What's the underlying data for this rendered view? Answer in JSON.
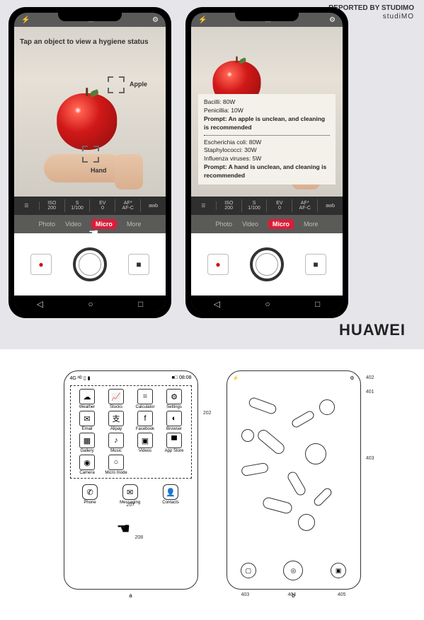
{
  "credit": {
    "line1": "REPORTED BY STUDIMO",
    "line2": "studiMO"
  },
  "phone": {
    "instruction": "Tap an object to view a hygiene status",
    "label_apple": "Apple",
    "label_hand": "Hand",
    "settings": [
      "",
      "ISO\n200",
      "S\n1/100",
      "EV\n0",
      "AF*\nAF-C",
      "awb"
    ],
    "modes": {
      "photo": "Photo",
      "video": "Video",
      "micro": "Micro",
      "more": "More"
    },
    "overlay": {
      "apple": {
        "bacilli": "Bacilli: 80W",
        "penicillia": "Penicillia: 10W",
        "prompt": "Prompt: An apple is unclean, and cleaning is recommended"
      },
      "hand": {
        "ecoli": "Escherichia coli: 80W",
        "staph": "Staphylococci: 30W",
        "flu": "Influenza viruses: 5W",
        "prompt": "Prompt: A hand is unclean, and cleaning is recommended"
      }
    }
  },
  "brand": "HUAWEI",
  "patent": {
    "time": "08:08",
    "apps": [
      {
        "label": "Weather",
        "g": "☁"
      },
      {
        "label": "Stocks",
        "g": "📈"
      },
      {
        "label": "Calculator",
        "g": "="
      },
      {
        "label": "Settings",
        "g": "⚙"
      },
      {
        "label": "Email",
        "g": "✉"
      },
      {
        "label": "Alipay",
        "g": "支"
      },
      {
        "label": "Facebook",
        "g": "f"
      },
      {
        "label": "Browser",
        "g": "◐"
      },
      {
        "label": "Gallery",
        "g": "▦"
      },
      {
        "label": "Music",
        "g": "♪"
      },
      {
        "label": "Videos",
        "g": "▣"
      },
      {
        "label": "App Store",
        "g": "▀"
      },
      {
        "label": "Camera",
        "g": "◉"
      },
      {
        "label": "Micro mode",
        "g": "○"
      }
    ],
    "dock": [
      {
        "label": "Phone",
        "g": "✆"
      },
      {
        "label": "Messaging",
        "g": "✉"
      },
      {
        "label": "Contacts",
        "g": "👤"
      }
    ],
    "refs": {
      "r202": "202",
      "r207": "207",
      "r208": "208",
      "r401": "401",
      "r402": "402",
      "r403a": "403",
      "r404": "404",
      "r405": "405",
      "r403b": "403"
    },
    "caps": {
      "a": "a",
      "b": "b"
    }
  }
}
